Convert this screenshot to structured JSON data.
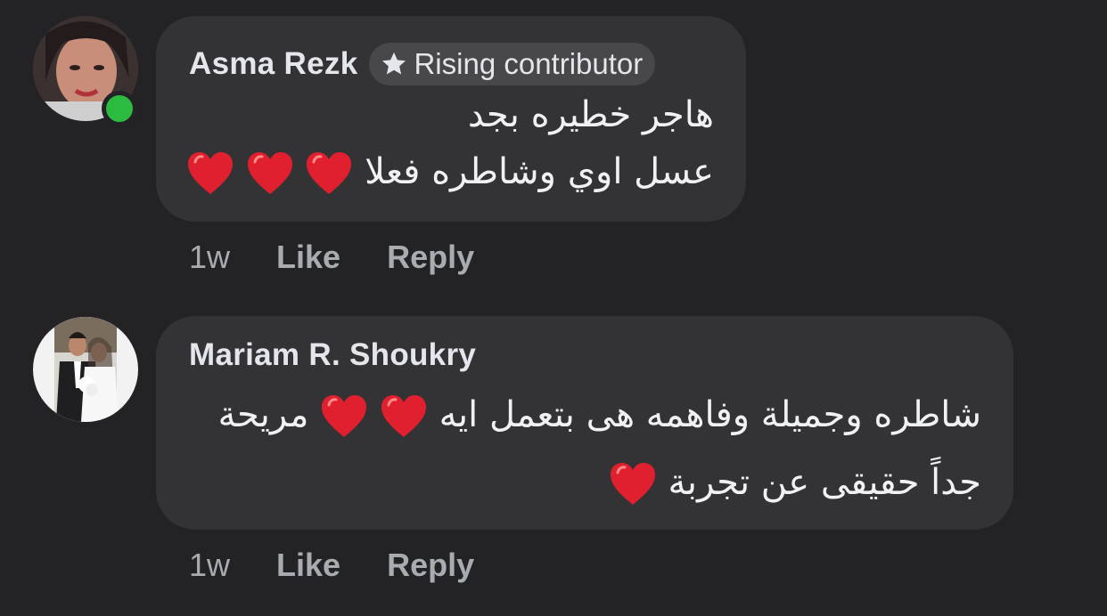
{
  "comments": [
    {
      "author": "Asma Rezk",
      "badge": "Rising contributor",
      "online": true,
      "lines": [
        "هاجر خطيره بجد",
        "عسل اوي وشاطره فعلا"
      ],
      "time": "1w",
      "like_label": "Like",
      "reply_label": "Reply"
    },
    {
      "author": "Mariam R. Shoukry",
      "lines": [
        "شاطره وجميلة وفاهمه هى بتعمل ايه",
        "مريحة",
        "جداً حقيقى عن تجربة"
      ],
      "time": "1w",
      "like_label": "Like",
      "reply_label": "Reply"
    }
  ],
  "colors": {
    "background": "#232325",
    "bubble": "#333335",
    "online": "#2abb3f",
    "heart": "#e0202e"
  },
  "icons": [
    "star-icon",
    "heart-emoji"
  ]
}
